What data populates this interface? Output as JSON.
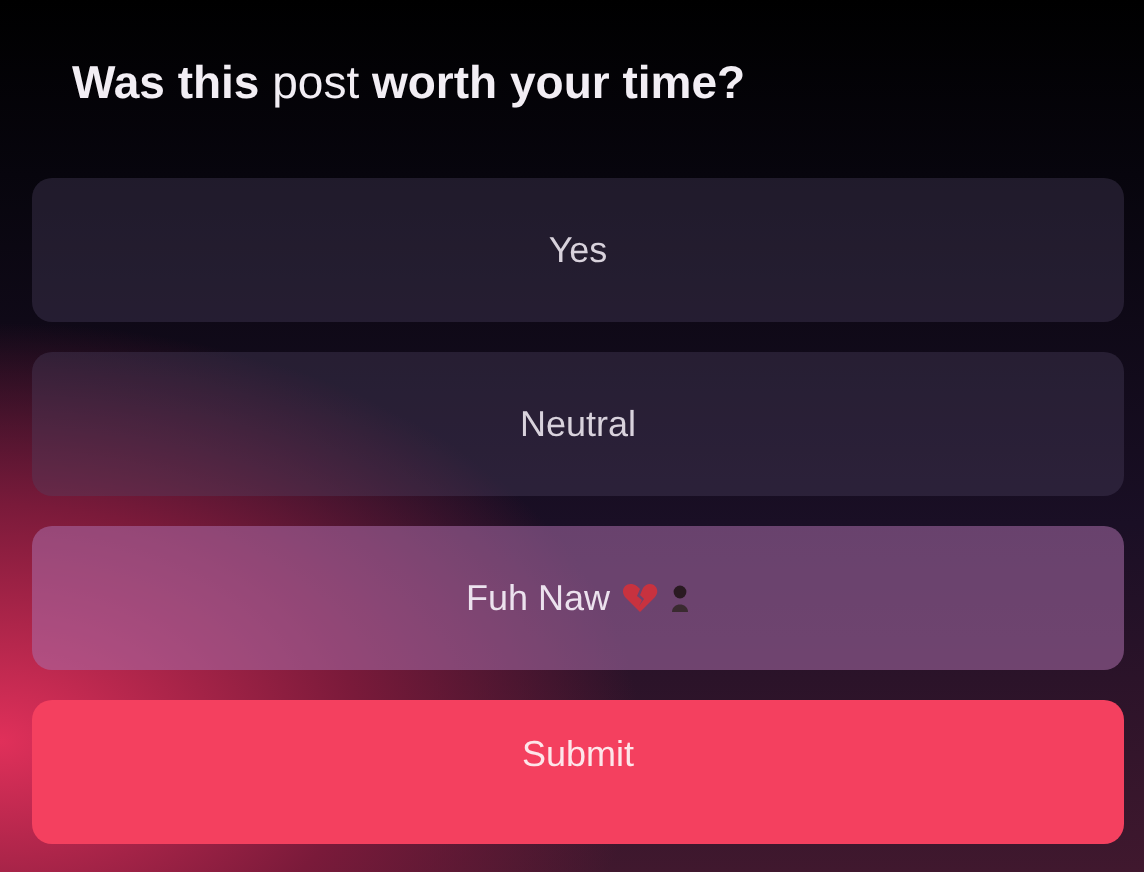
{
  "title": "**Was this** post **worth your time?**",
  "options": [
    {
      "label": "Yes",
      "selected": false
    },
    {
      "label": "Neutral",
      "selected": false
    },
    {
      "label": "Fuh Naw",
      "selected": true
    }
  ],
  "submit": "Submit"
}
